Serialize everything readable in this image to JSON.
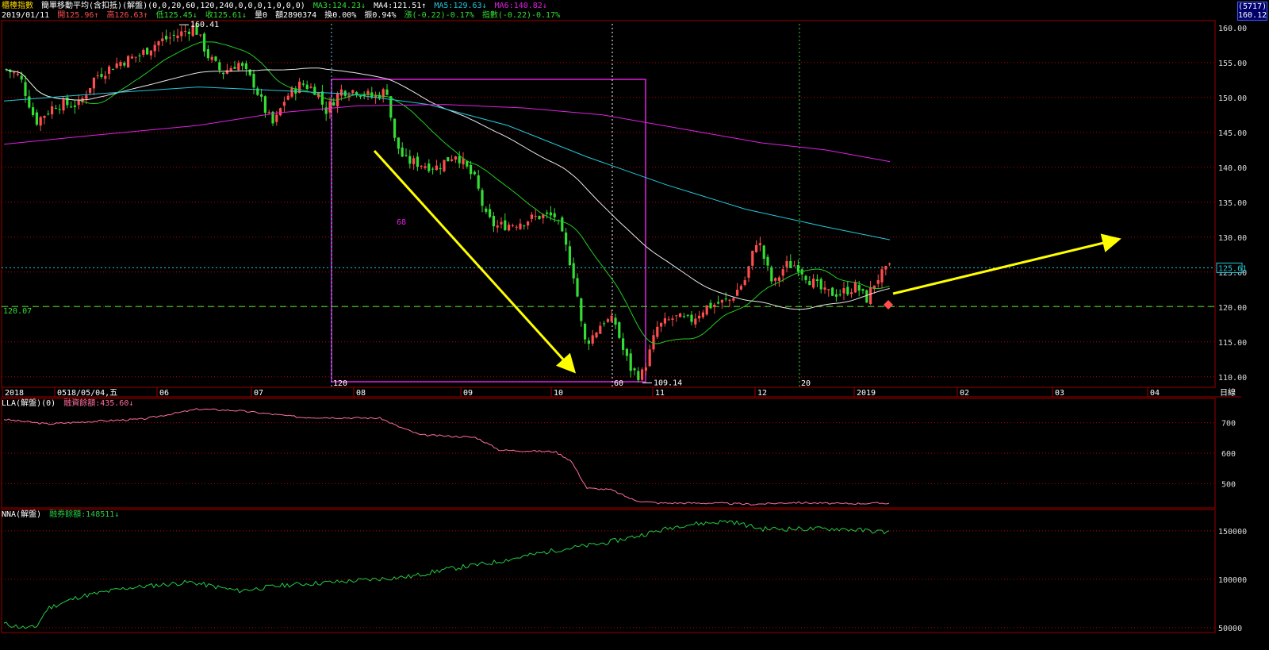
{
  "header": {
    "line1": {
      "index_name": "櫃檯指數",
      "indicator": "簡單移動平均(含扣抵)(解盤)(0,0,20,60,120,240,0,0,0,1,0,0,0)",
      "ma3": "MA3:124.23↓",
      "ma4": "MA4:121.51↑",
      "ma5": "MA5:129.63↓",
      "ma6": "MA6:140.82↓"
    },
    "line2": {
      "date": "2019/01/11",
      "open": "開125.96↑",
      "high": "高126.63↑",
      "low": "低125.45↓",
      "close": "收125.61↓",
      "vol": "量0",
      "amount": "額2890374",
      "turnover": "換0.00%",
      "amplitude": "振0.94%",
      "change": "漲(-0.22)-0.17%",
      "index_change": "指數(-0.22)-0.17%"
    }
  },
  "price_tag": {
    "code": "(5717)",
    "price": "160.12"
  },
  "main_chart": {
    "y_ticks": [
      "155.00",
      "150.00",
      "145.00",
      "140.00",
      "135.00",
      "130.00",
      "125.00",
      "120.00",
      "115.00",
      "110.00"
    ],
    "y_top_label": "160.00",
    "x_labels": [
      "2018",
      "05",
      "06",
      "07",
      "08",
      "09",
      "10",
      "11",
      "12",
      "2019",
      "02",
      "03",
      "04",
      "日線"
    ],
    "cursor_date": "18/05/04,五",
    "high_label": "160.41",
    "low_label": "109.14",
    "last_label": "125.61",
    "support_label": "120.07",
    "count_box": "68",
    "v_markers": [
      "120",
      "60",
      "20"
    ]
  },
  "lla_panel": {
    "title": "LLA(解盤)(0)",
    "value": "融資餘額:435.60↓",
    "y_ticks": [
      "700",
      "600",
      "500"
    ]
  },
  "nna_panel": {
    "title": "NNA(解盤)",
    "value": "融券餘額:148511↓",
    "y_ticks": [
      "150000",
      "100000",
      "50000"
    ]
  },
  "colors": {
    "up": "#ff4d4d",
    "down": "#33dd33",
    "ma20": "#22cc22",
    "ma60": "#e8e8e8",
    "ma120": "#22c8d8",
    "ma240": "#e020e0",
    "grid": "#c00000",
    "arrow": "#ffff00",
    "lla": "#ff6fa0",
    "nna": "#22cc44"
  },
  "chart_data": {
    "type": "candlestick",
    "series": [
      {
        "name": "MA3",
        "values": [
          124.23
        ]
      },
      {
        "name": "MA4",
        "values": [
          121.51
        ]
      },
      {
        "name": "MA5",
        "values": [
          129.63
        ]
      },
      {
        "name": "MA6",
        "values": [
          140.82
        ]
      }
    ],
    "ylim": [
      108.5,
      161
    ],
    "xlabel": "",
    "ylabel": "",
    "last": {
      "date": "2019/01/11",
      "open": 125.96,
      "high": 126.63,
      "low": 125.45,
      "close": 125.61
    },
    "high": 160.41,
    "low": 109.14,
    "support": 120.07,
    "lla": {
      "ylim": [
        420,
        780
      ],
      "range": [
        711,
        436
      ]
    },
    "nna": {
      "ylim": [
        45000,
        172000
      ],
      "range": [
        52000,
        148511
      ]
    }
  }
}
